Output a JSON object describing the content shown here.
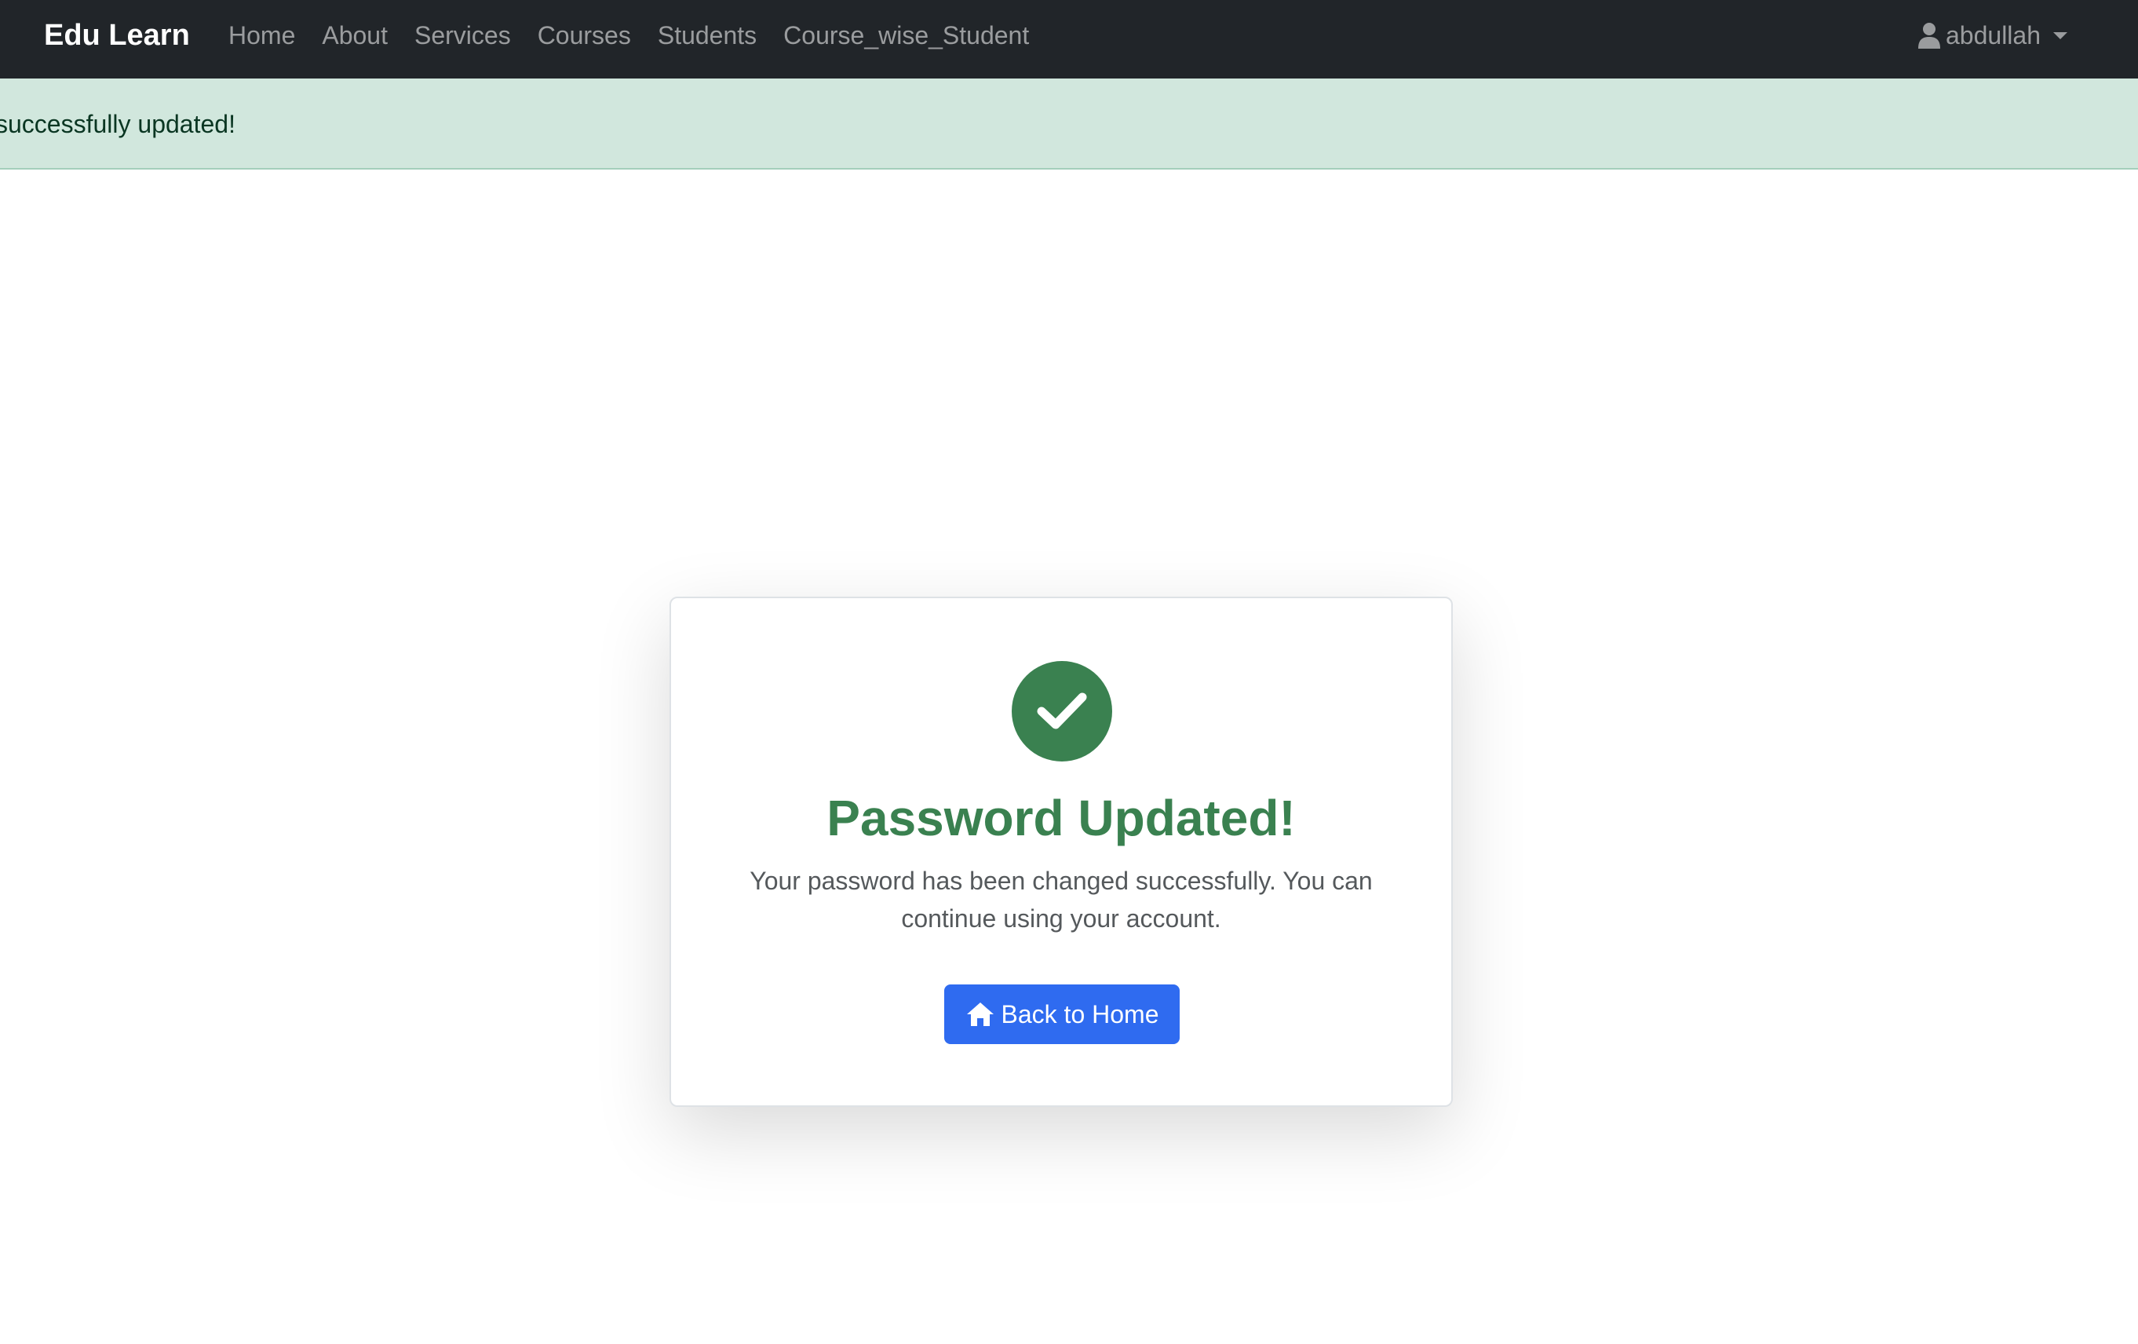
{
  "navbar": {
    "brand": "Edu Learn",
    "links": [
      "Home",
      "About",
      "Services",
      "Courses",
      "Students",
      "Course_wise_Student"
    ],
    "user": {
      "icon": "user-icon",
      "name": "abdullah"
    }
  },
  "alert": {
    "message": "successfully updated!"
  },
  "card": {
    "icon": "check-circle-icon",
    "title": "Password Updated!",
    "text": "Your password has been changed successfully. You can continue using your account.",
    "button": {
      "icon": "home-icon",
      "label": "Back to Home"
    }
  },
  "colors": {
    "navbar_bg": "#212529",
    "alert_bg": "#d1e7dd",
    "success": "#3a8150",
    "primary": "#2f6bf0"
  }
}
